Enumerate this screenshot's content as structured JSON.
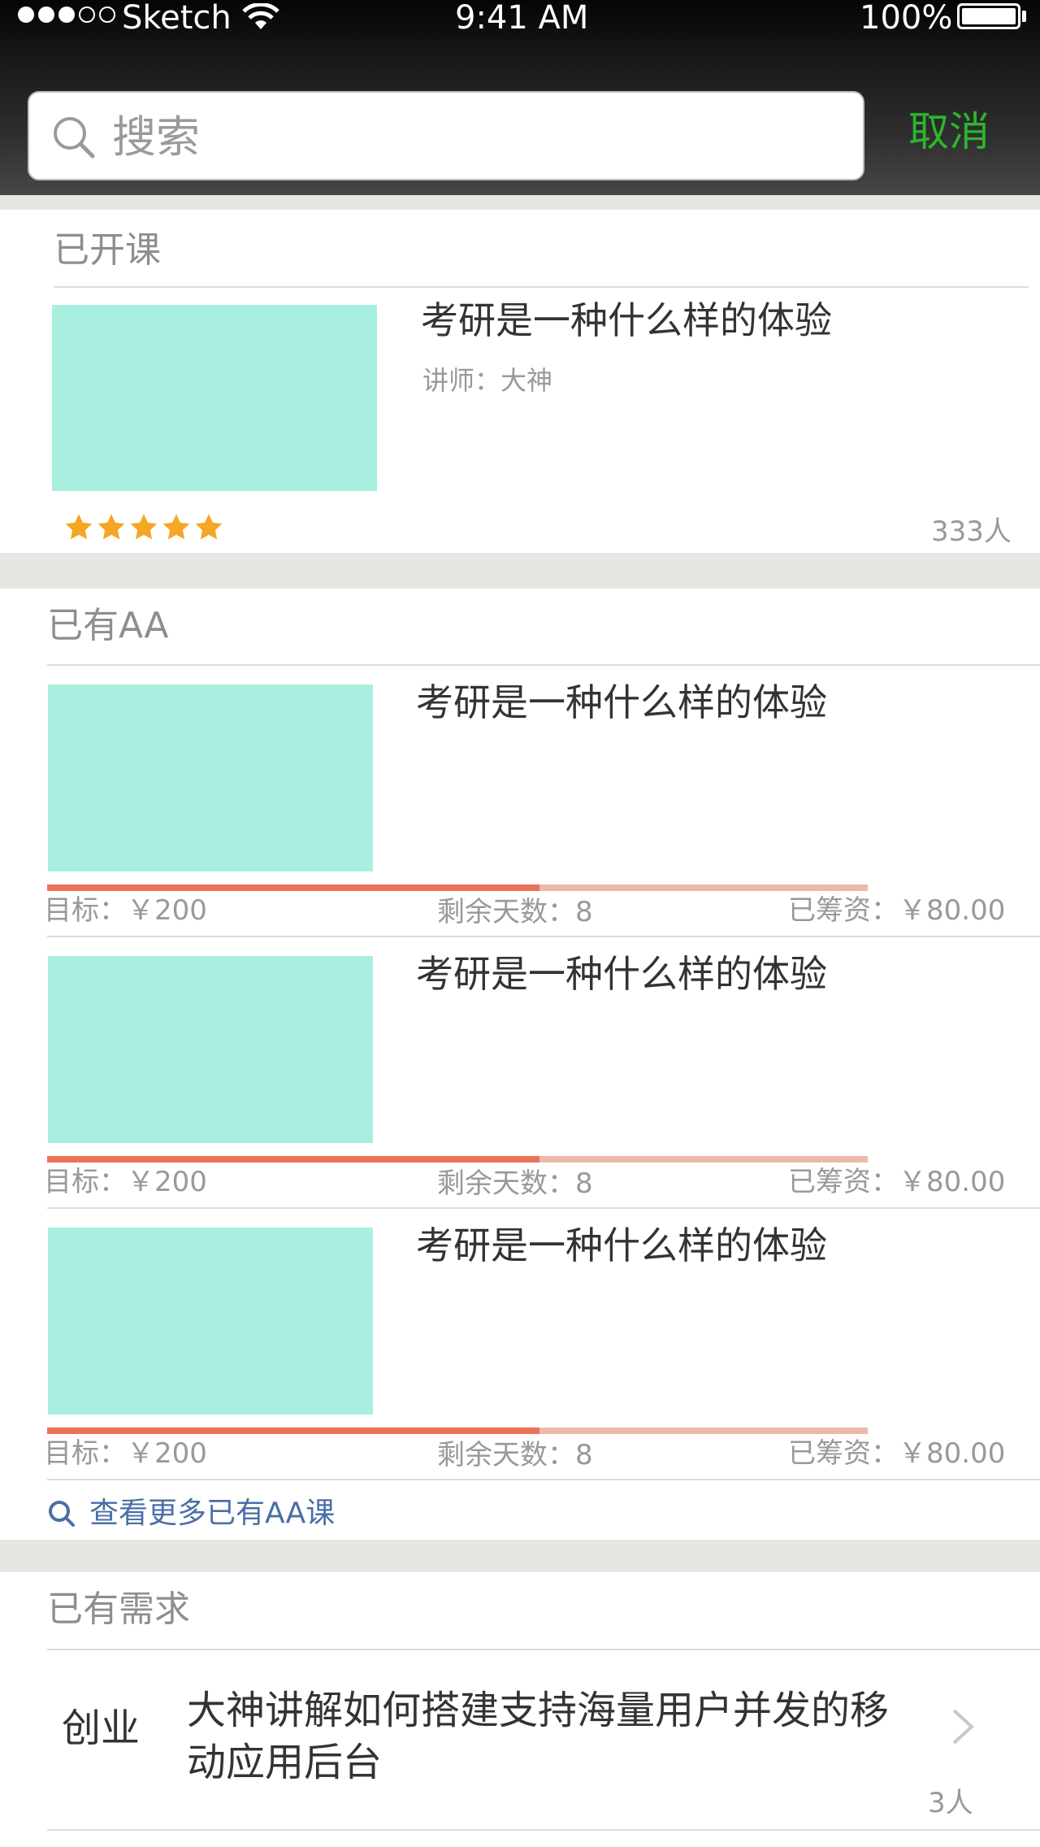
{
  "status_bar": {
    "carrier": "Sketch",
    "time": "9:41 AM",
    "battery": "100%"
  },
  "search": {
    "placeholder": "搜索",
    "value": "",
    "cancel_label": "取消"
  },
  "opened": {
    "title": "已开课",
    "course": {
      "title": "考研是一种什么样的体验",
      "teacher": "讲师：大神",
      "rating": 5,
      "count": "333人"
    }
  },
  "aa": {
    "title": "已有AA",
    "items": [
      {
        "title": "考研是一种什么样的体验",
        "target": "目标：￥200",
        "days": "剩余天数：8",
        "raised": "已筹资：￥80.00",
        "progress": 0.6
      },
      {
        "title": "考研是一种什么样的体验",
        "target": "目标：￥200",
        "days": "剩余天数：8",
        "raised": "已筹资：￥80.00",
        "progress": 0.6
      },
      {
        "title": "考研是一种什么样的体验",
        "target": "目标：￥200",
        "days": "剩余天数：8",
        "raised": "已筹资：￥80.00",
        "progress": 0.6
      }
    ],
    "more_label": "查看更多已有AA课"
  },
  "needs": {
    "title": "已有需求",
    "item": {
      "category": "创业",
      "text": "大神讲解如何搭建支持海量用户并发的移动应用后台",
      "count": "3人"
    }
  },
  "colors": {
    "accent_green": "#2db52d",
    "thumb": "#a8efdf",
    "progress": "#e9735a",
    "star": "#f5a623",
    "link": "#4a6fa5"
  }
}
